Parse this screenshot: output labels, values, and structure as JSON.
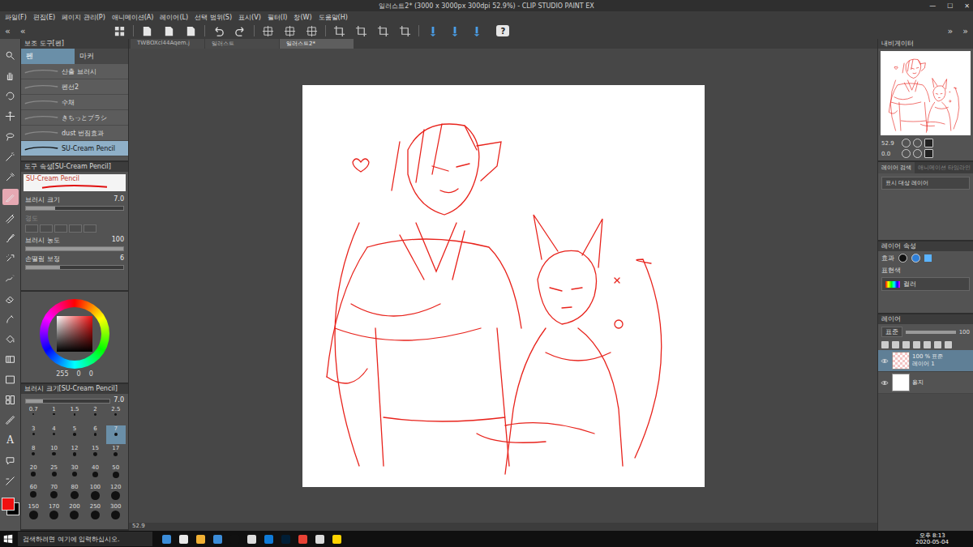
{
  "window": {
    "title": "일러스트2* (3000 x 3000px 300dpi 52.9%) - CLIP STUDIO PAINT EX",
    "controls": [
      "—",
      "☐",
      "✕"
    ]
  },
  "menu": [
    "파일(F)",
    "편집(E)",
    "페이지 관리(P)",
    "애니메이션(A)",
    "레이어(L)",
    "선택 범위(S)",
    "표시(V)",
    "필터(I)",
    "창(W)",
    "도움말(H)"
  ],
  "collapse_left": [
    "«",
    "«"
  ],
  "collapse_right": [
    "»",
    "»"
  ],
  "command_bar": {
    "help": "?"
  },
  "tools": [
    {
      "kind": "zoom",
      "selected": false
    },
    {
      "kind": "hand",
      "selected": false
    },
    {
      "kind": "rotate",
      "selected": false
    },
    {
      "kind": "move",
      "selected": false
    },
    {
      "kind": "lasso",
      "selected": false
    },
    {
      "kind": "wand",
      "selected": false
    },
    {
      "kind": "eyedropper",
      "selected": false
    },
    {
      "kind": "pen",
      "selected": true
    },
    {
      "kind": "pencil",
      "selected": false
    },
    {
      "kind": "brush",
      "selected": false
    },
    {
      "kind": "airbrush",
      "selected": false
    },
    {
      "kind": "deco",
      "selected": false
    },
    {
      "kind": "eraser",
      "selected": false
    },
    {
      "kind": "blend",
      "selected": false
    },
    {
      "kind": "fill",
      "selected": false
    },
    {
      "kind": "gradient",
      "selected": false
    },
    {
      "kind": "figure",
      "selected": false
    },
    {
      "kind": "frame",
      "selected": false
    },
    {
      "kind": "ruler",
      "selected": false
    },
    {
      "kind": "text",
      "label": "A",
      "selected": false
    },
    {
      "kind": "balloon",
      "selected": false
    },
    {
      "kind": "line",
      "selected": false
    }
  ],
  "sub_tool": {
    "title": "보조 도구[펜]",
    "tabs": [
      {
        "label": "펜",
        "selected": true
      },
      {
        "label": "마커",
        "selected": false
      }
    ],
    "brushes": [
      {
        "name": "산출 브러시",
        "selected": false
      },
      {
        "name": "펜선2",
        "selected": false
      },
      {
        "name": "수채",
        "selected": false
      },
      {
        "name": "きちっとブラシ",
        "selected": false
      },
      {
        "name": "dust 번짐효과",
        "selected": false
      },
      {
        "name": "SU-Cream Pencil",
        "selected": true
      }
    ]
  },
  "tool_property": {
    "title": "도구 속성[SU-Cream Pencil]",
    "preview": "SU-Cream Pencil",
    "rows": [
      {
        "kind": "slider",
        "label": "브러시 크기",
        "value": "7.0",
        "level": 0.3
      },
      {
        "kind": "boxes",
        "label": "경도",
        "disabled": true
      },
      {
        "kind": "slider",
        "label": "브러시 농도",
        "value": "100",
        "level": 1.0
      },
      {
        "kind": "slider",
        "label": "손떨림 보정",
        "value": "6",
        "level": 0.35
      }
    ]
  },
  "color": {
    "values": [
      "255",
      "0",
      "0"
    ],
    "foreground": "#f01010",
    "background": "#000000"
  },
  "brush_size": {
    "title": "브러시 크기[SU-Cream Pencil]",
    "value": "7.0",
    "level": 0.2,
    "sizes": [
      {
        "v": "0.7",
        "selected": false
      },
      {
        "v": "1",
        "selected": false
      },
      {
        "v": "1.5",
        "selected": false
      },
      {
        "v": "2",
        "selected": false
      },
      {
        "v": "2.5",
        "selected": false
      },
      {
        "v": "3",
        "selected": false
      },
      {
        "v": "4",
        "selected": false
      },
      {
        "v": "5",
        "selected": false
      },
      {
        "v": "6",
        "selected": false
      },
      {
        "v": "7",
        "selected": true
      },
      {
        "v": "8",
        "selected": false
      },
      {
        "v": "10",
        "selected": false
      },
      {
        "v": "12",
        "selected": false
      },
      {
        "v": "15",
        "selected": false
      },
      {
        "v": "17",
        "selected": false
      },
      {
        "v": "20",
        "selected": false
      },
      {
        "v": "25",
        "selected": false
      },
      {
        "v": "30",
        "selected": false
      },
      {
        "v": "40",
        "selected": false
      },
      {
        "v": "50",
        "selected": false
      },
      {
        "v": "60",
        "selected": false
      },
      {
        "v": "70",
        "selected": false
      },
      {
        "v": "80",
        "selected": false
      },
      {
        "v": "100",
        "selected": false
      },
      {
        "v": "120",
        "selected": false
      },
      {
        "v": "150",
        "selected": false
      },
      {
        "v": "170",
        "selected": false
      },
      {
        "v": "200",
        "selected": false
      },
      {
        "v": "250",
        "selected": false
      },
      {
        "v": "300",
        "selected": false
      }
    ]
  },
  "canvas_tabs": [
    {
      "label": "TWBOXcl44Aqem.j",
      "selected": false
    },
    {
      "label": "일러스트",
      "selected": false
    },
    {
      "label": "일러스트2*",
      "selected": true
    }
  ],
  "status": {
    "zoom": "52.9"
  },
  "navigator": {
    "title": "내비게이터",
    "zoom": "52.9",
    "angle": "0.0"
  },
  "layer_search": {
    "tabs": [
      {
        "label": "레이어 검색",
        "selected": true
      },
      {
        "label": "애니메이션 타임라인",
        "selected": false
      }
    ],
    "target": "표시 대상 레이어"
  },
  "layer_property": {
    "title": "레이어 속성",
    "effect": "효과",
    "color_label": "표현색",
    "color_value": "컬러"
  },
  "layers": {
    "title": "레이어",
    "blend": "표준",
    "opacity": "100",
    "items": [
      {
        "kind": "raster",
        "mode": "100 % 표준",
        "name": "레이어 1",
        "visible": true,
        "selected": true
      },
      {
        "kind": "paper",
        "name": "용지",
        "visible": true,
        "selected": false
      }
    ]
  },
  "taskbar": {
    "search": "검색하려면 여기에 입력하십시오.",
    "time": "오후 8:13",
    "date": "2020-05-04"
  }
}
